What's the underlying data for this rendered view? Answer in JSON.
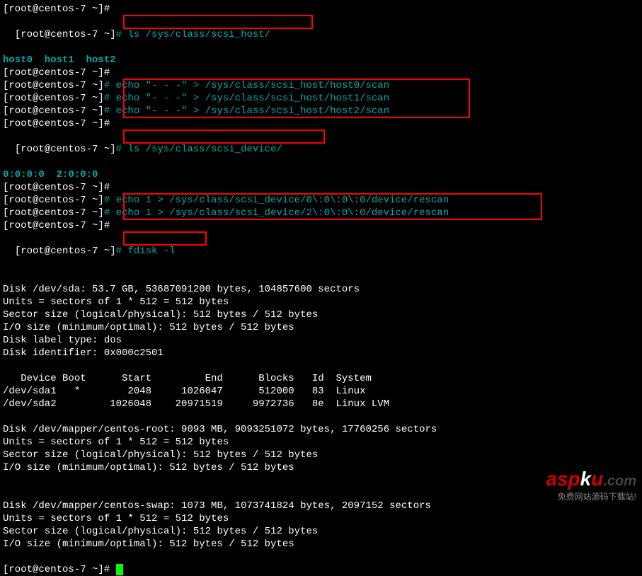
{
  "prompt": "[root@centos-7 ~]#",
  "lines": {
    "l1": "[root@centos-7 ~]# ",
    "l2_prompt": "[root@centos-7 ~]",
    "l2_cmd": "# ls /sys/class/scsi_host/",
    "l3_hosts": "host0  host1  host2",
    "l4": "[root@centos-7 ~]# ",
    "l5_prompt": "[root@centos-7 ~]",
    "l5_cmd": "# echo \"- - -\" > /sys/class/scsi_host/host0/scan",
    "l6_prompt": "[root@centos-7 ~]",
    "l6_cmd": "# echo \"- - -\" > /sys/class/scsi_host/host1/scan",
    "l7_prompt": "[root@centos-7 ~]",
    "l7_cmd": "# echo \"- - -\" > /sys/class/scsi_host/host2/scan",
    "l8": "[root@centos-7 ~]# ",
    "l9_prompt": "[root@centos-7 ~]",
    "l9_cmd": "# ls /sys/class/scsi_device/",
    "l10_devices": "0:0:0:0  2:0:0:0",
    "l11": "[root@centos-7 ~]# ",
    "l12_prompt": "[root@centos-7 ~]",
    "l12_cmd": "# echo 1 > /sys/class/scsi_device/0\\:0\\:0\\:0/device/rescan",
    "l13_prompt": "[root@centos-7 ~]",
    "l13_cmd": "# echo 1 > /sys/class/scsi_device/2\\:0\\:0\\:0/device/rescan",
    "l14": "[root@centos-7 ~]# ",
    "l15_prompt": "[root@centos-7 ~]",
    "l15_cmd": "# fdisk -l",
    "fdisk": {
      "disk1": "Disk /dev/sda: 53.7 GB, 53687091200 bytes, 104857600 sectors",
      "units": "Units = sectors of 1 * 512 = 512 bytes",
      "sector": "Sector size (logical/physical): 512 bytes / 512 bytes",
      "iosize": "I/O size (minimum/optimal): 512 bytes / 512 bytes",
      "label": "Disk label type: dos",
      "ident": "Disk identifier: 0x000c2501",
      "header": "   Device Boot      Start         End      Blocks   Id  System",
      "row1": "/dev/sda1   *        2048     1026047      512000   83  Linux",
      "row2": "/dev/sda2         1026048    20971519     9972736   8e  Linux LVM",
      "disk2": "Disk /dev/mapper/centos-root: 9093 MB, 9093251072 bytes, 17760256 sectors",
      "disk3": "Disk /dev/mapper/centos-swap: 1073 MB, 1073741824 bytes, 2097152 sectors"
    },
    "last_prompt": "[root@centos-7 ~]# "
  },
  "watermark": {
    "brand_a": "asp",
    "brand_k": "k",
    "brand_u": "u",
    "dotcom": ".com",
    "tag": "免费网站源码下载站!"
  },
  "colors": {
    "bg": "#000000",
    "text": "#ffffff",
    "teal": "#00aaaa",
    "red": "#ff0000",
    "cursor": "#00ff00"
  }
}
